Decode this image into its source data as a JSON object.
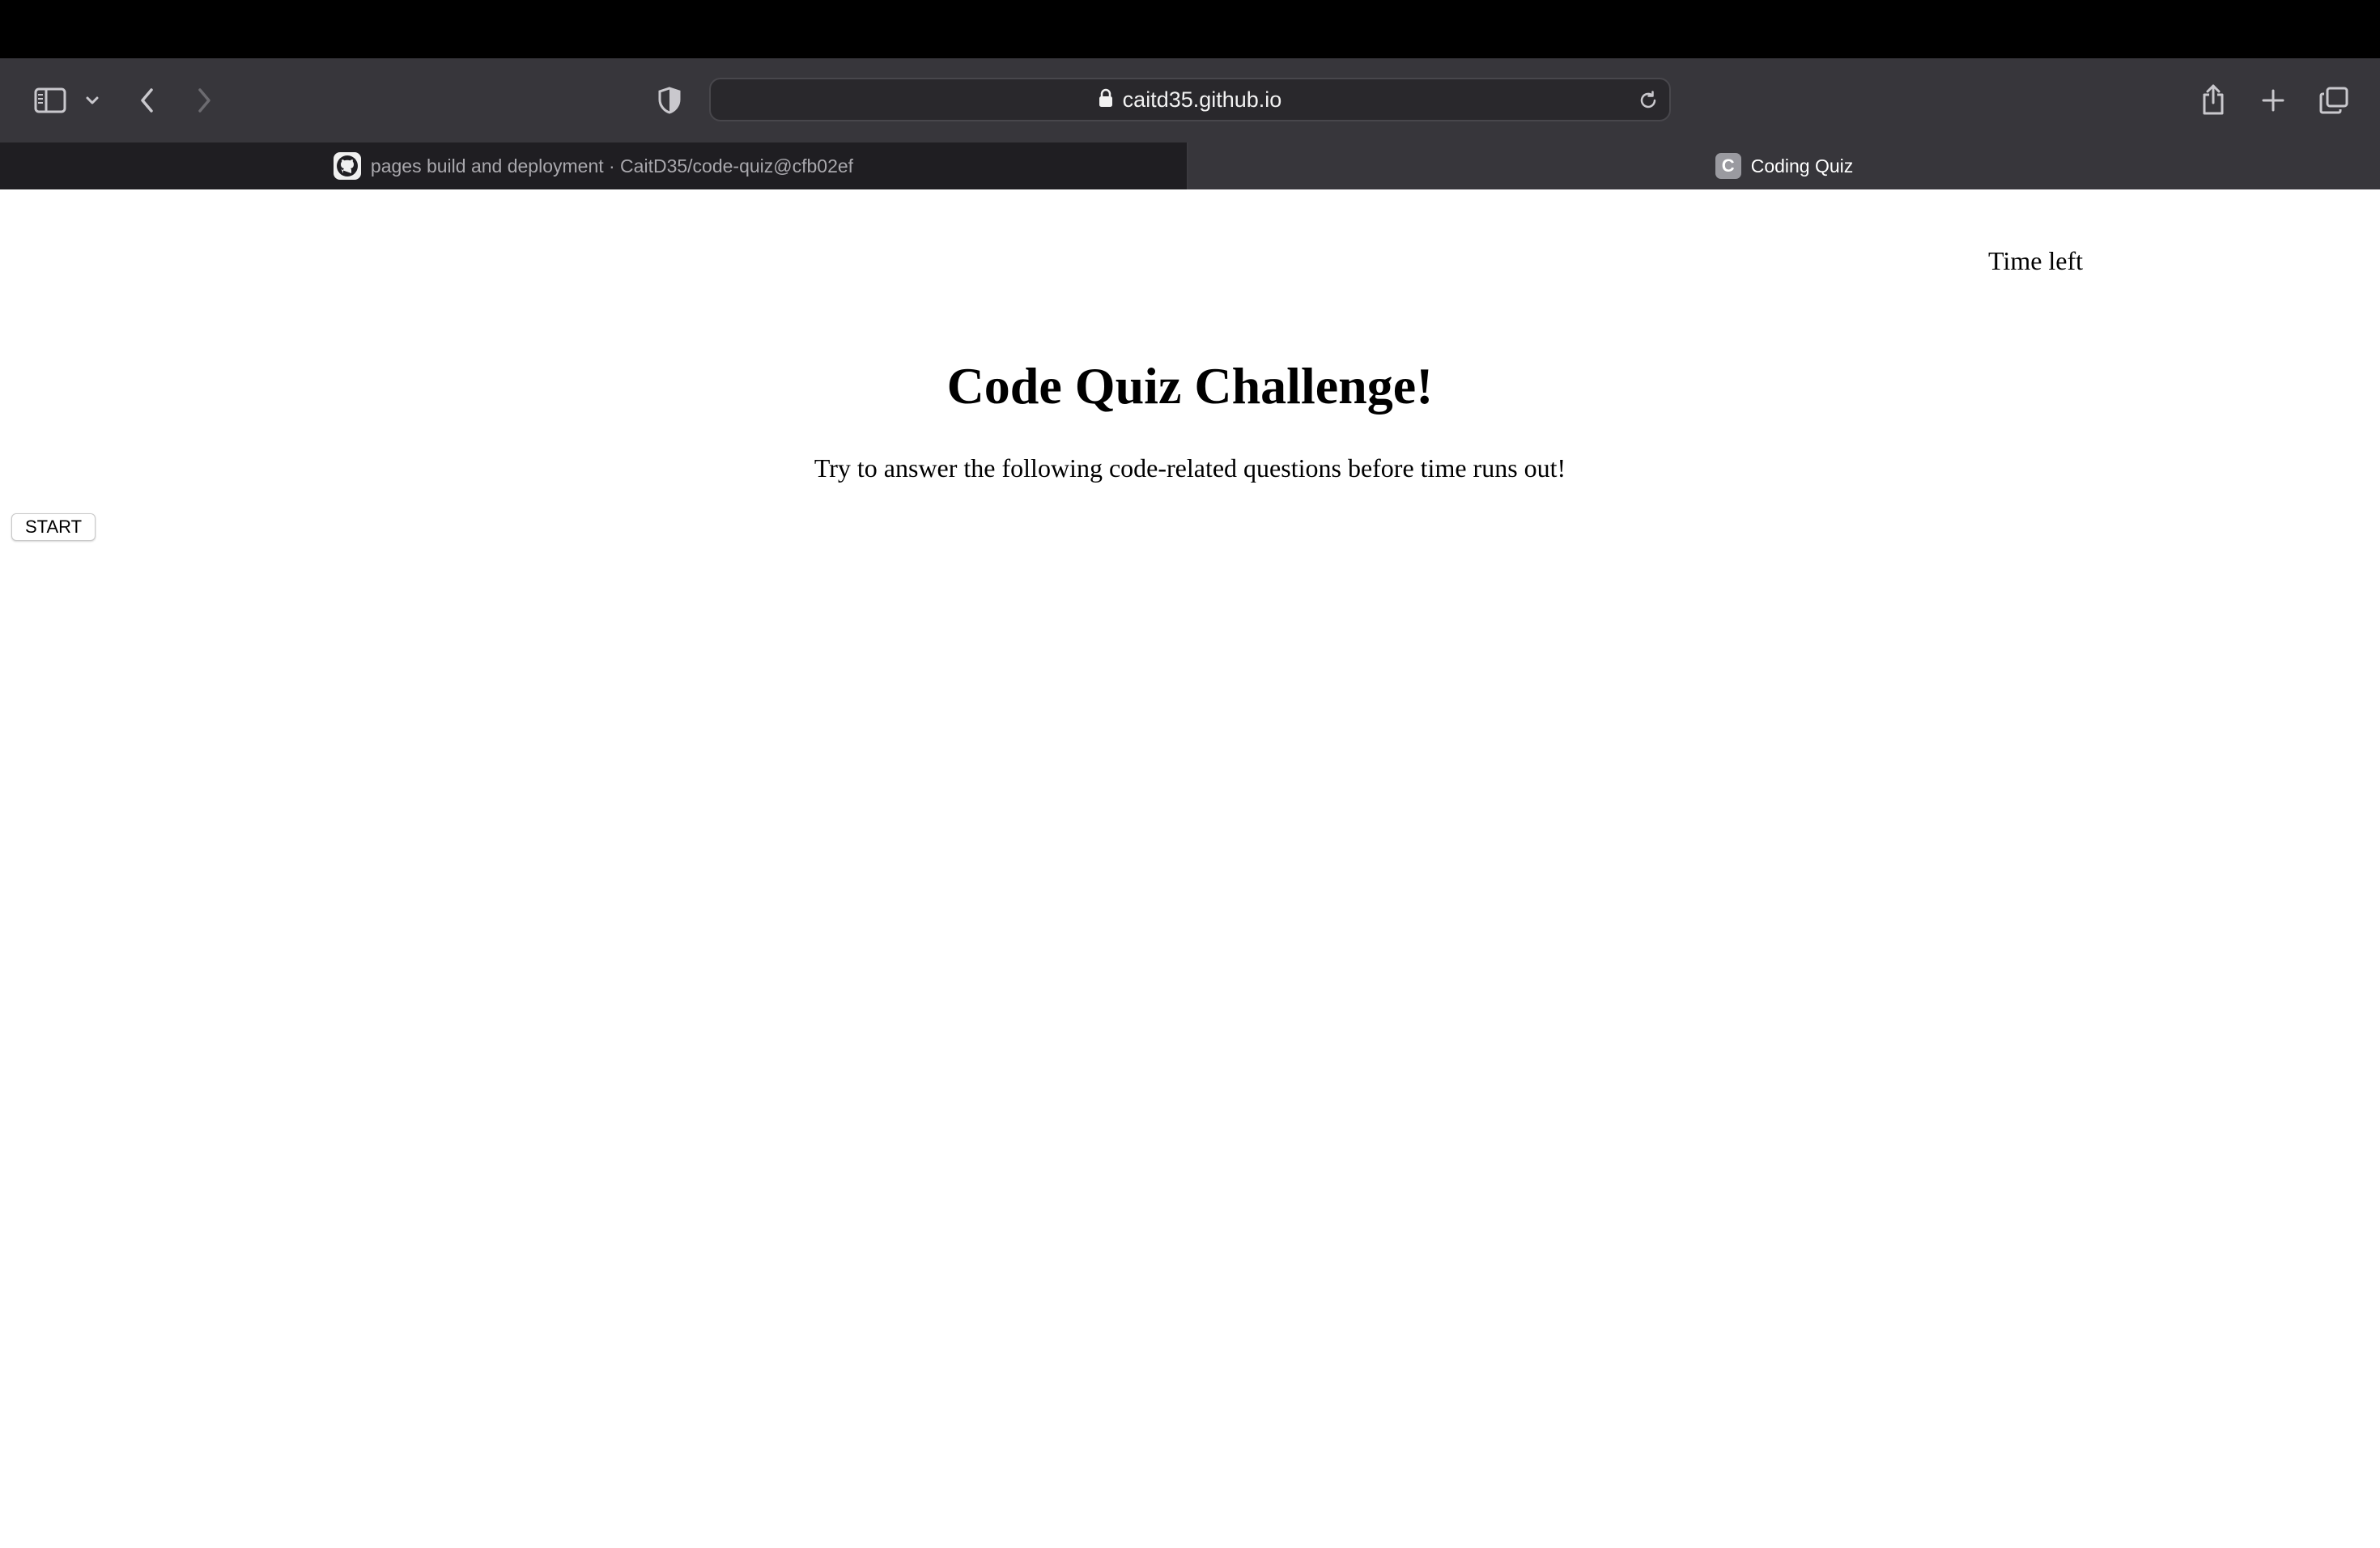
{
  "browser": {
    "url": "caitd35.github.io",
    "tabs": [
      {
        "label": "pages build and deployment · CaitD35/code-quiz@cfb02ef",
        "favicon": "github-icon",
        "active": false
      },
      {
        "label": "Coding Quiz",
        "favicon": "C",
        "active": true
      }
    ],
    "toolbar_icons": [
      "sidebar-icon",
      "chevron-down-icon",
      "back-arrow-icon",
      "forward-arrow-icon",
      "shield-icon",
      "lock-icon",
      "reload-icon",
      "share-icon",
      "plus-icon",
      "tabs-overview-icon"
    ]
  },
  "page": {
    "timer_label": "Time left",
    "title": "Code Quiz Challenge!",
    "subtitle": "Try to answer the following code-related questions before time runs out!",
    "start_button": "START"
  },
  "colors": {
    "menubar": "#000000",
    "toolbar": "#37363b",
    "tabbar_inactive": "#1f1e22",
    "tab_active": "#37363b",
    "page_background": "#ffffff"
  }
}
